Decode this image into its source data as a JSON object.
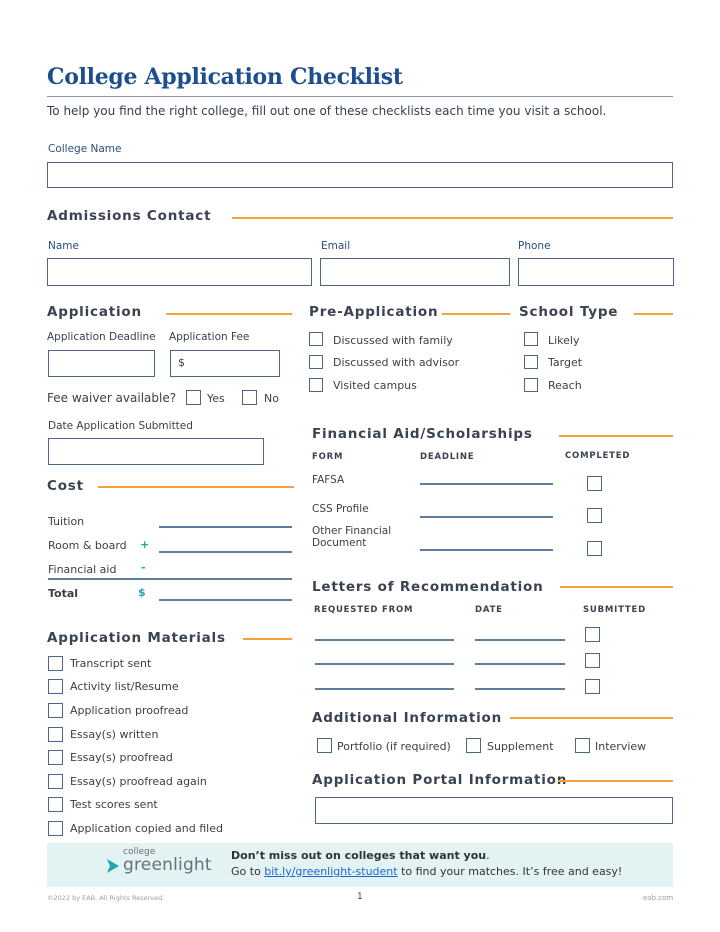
{
  "header": {
    "title": "College Application Checklist",
    "intro": "To help you find the right college, fill out one of these checklists each time you visit a school."
  },
  "college_name": {
    "label": "College Name",
    "value": ""
  },
  "admissions_contact": {
    "heading": "Admissions Contact",
    "fields": [
      {
        "label": "Name",
        "value": ""
      },
      {
        "label": "Email",
        "value": ""
      },
      {
        "label": "Phone",
        "value": ""
      }
    ]
  },
  "application": {
    "heading": "Application",
    "deadline_label": "Application Deadline",
    "deadline_value": "",
    "fee_label": "Application Fee",
    "fee_prefix": "$",
    "fee_value": "",
    "fee_waiver_label": "Fee waiver available?",
    "fee_waiver_options": [
      {
        "label": "Yes",
        "checked": false
      },
      {
        "label": "No",
        "checked": false
      }
    ],
    "date_submitted_label": "Date Application Submitted",
    "date_submitted_value": ""
  },
  "pre_application": {
    "heading": "Pre-Application",
    "items": [
      {
        "label": "Discussed with family",
        "checked": false
      },
      {
        "label": "Discussed with advisor",
        "checked": false
      },
      {
        "label": "Visited campus",
        "checked": false
      }
    ]
  },
  "school_type": {
    "heading": "School Type",
    "items": [
      {
        "label": "Likely",
        "checked": false
      },
      {
        "label": "Target",
        "checked": false
      },
      {
        "label": "Reach",
        "checked": false
      }
    ]
  },
  "cost": {
    "heading": "Cost",
    "rows": [
      {
        "label": "Tuition",
        "symbol": ""
      },
      {
        "label": "Room & board",
        "symbol": "+"
      },
      {
        "label": "Financial aid",
        "symbol": "-"
      },
      {
        "label": "Total",
        "symbol": "$"
      }
    ]
  },
  "financial_aid": {
    "heading": "Financial Aid/Scholarships",
    "columns": [
      "FORM",
      "DEADLINE",
      "COMPLETED"
    ],
    "rows": [
      {
        "form": "FAFSA",
        "deadline": "",
        "completed": false
      },
      {
        "form": "CSS Profile",
        "deadline": "",
        "completed": false
      },
      {
        "form": "Other Financial Document",
        "form_line1": "Other Financial",
        "form_line2": "Document",
        "deadline": "",
        "completed": false
      }
    ]
  },
  "letters": {
    "heading": "Letters of Recommendation",
    "columns": [
      "REQUESTED FROM",
      "DATE",
      "SUBMITTED"
    ],
    "rows": [
      {
        "requested_from": "",
        "date": "",
        "submitted": false
      },
      {
        "requested_from": "",
        "date": "",
        "submitted": false
      },
      {
        "requested_from": "",
        "date": "",
        "submitted": false
      }
    ]
  },
  "materials": {
    "heading": "Application Materials",
    "items": [
      {
        "label": "Transcript sent",
        "checked": false
      },
      {
        "label": "Activity list/Resume",
        "checked": false
      },
      {
        "label": "Application proofread",
        "checked": false
      },
      {
        "label": "Essay(s) written",
        "checked": false
      },
      {
        "label": "Essay(s) proofread",
        "checked": false
      },
      {
        "label": "Essay(s) proofread again",
        "checked": false
      },
      {
        "label": "Test scores sent",
        "checked": false
      },
      {
        "label": "Application copied and filed",
        "checked": false
      }
    ]
  },
  "additional_info": {
    "heading": "Additional Information",
    "items": [
      {
        "label": "Portfolio (if required)",
        "checked": false
      },
      {
        "label": "Supplement",
        "checked": false
      },
      {
        "label": "Interview",
        "checked": false
      }
    ]
  },
  "portal": {
    "heading": "Application Portal Information",
    "value": ""
  },
  "banner": {
    "logo_small": "college",
    "logo_large": "greenlight",
    "headline": "Don’t miss out on colleges that want you",
    "headline_end": ".",
    "line_prefix": "Go to ",
    "link_text": "bit.ly/greenlight-student",
    "line_suffix": " to find your matches. It’s free and easy!",
    "colors": {
      "background": "#e3f3f4",
      "logo_teal": "#1ea7b0",
      "link": "#1a66d1"
    }
  },
  "footer": {
    "copyright": "©2022 by EAB. All Rights Reserved.",
    "page_number": "1",
    "site": "eab.com"
  },
  "colors": {
    "title_blue": "#1d4f8c",
    "accent_orange": "#f0a33c",
    "field_border": "#4c6785"
  }
}
